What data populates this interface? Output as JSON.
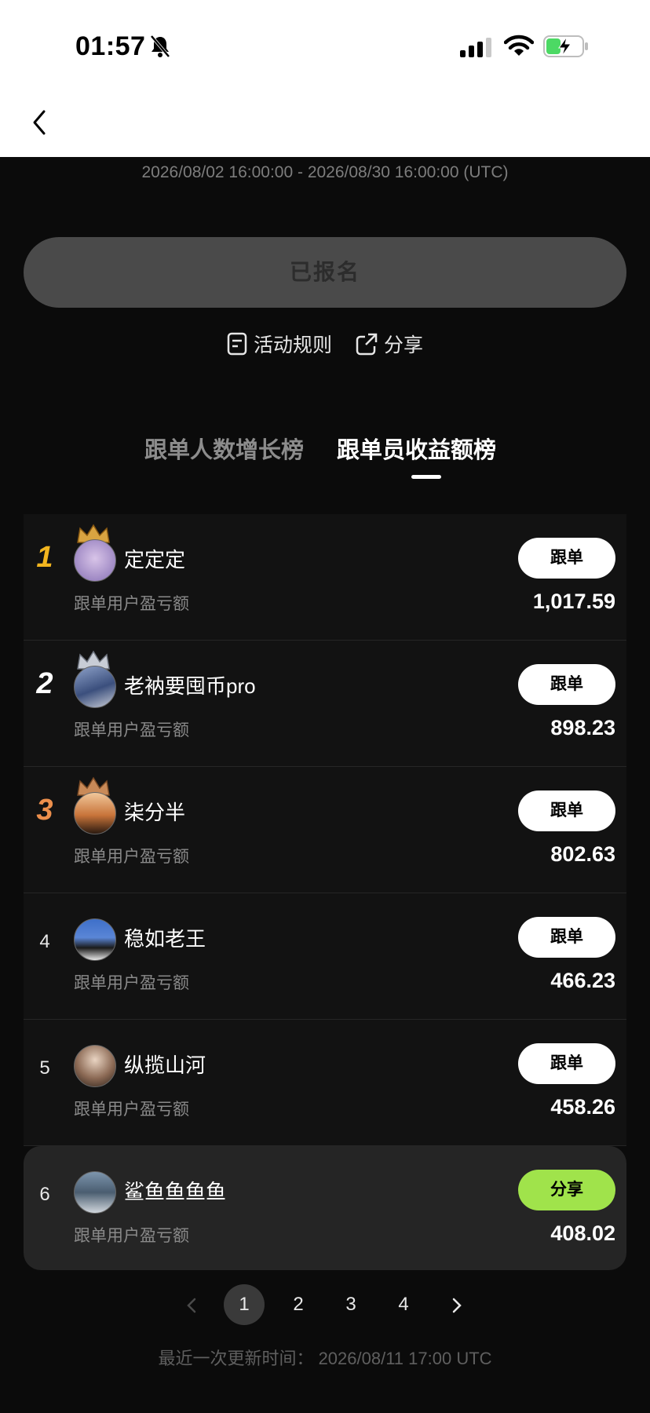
{
  "status_bar": {
    "time": "01:57"
  },
  "event": {
    "date_range": "2026/08/02 16:00:00 - 2026/08/30 16:00:00 (UTC)",
    "registered_label": "已报名",
    "rules_label": "活动规则",
    "share_label": "分享"
  },
  "tabs": [
    {
      "label": "跟单人数增长榜",
      "active": false
    },
    {
      "label": "跟单员收益额榜",
      "active": true
    }
  ],
  "leaderboard": [
    {
      "rank": "1",
      "name": "定定定",
      "sub": "跟单用户盈亏额",
      "value": "1,017.59",
      "button": "跟单",
      "rank_color": "#f2b51f",
      "crown": "#d9a441"
    },
    {
      "rank": "2",
      "name": "老衲要囤币pro",
      "sub": "跟单用户盈亏额",
      "value": "898.23",
      "button": "跟单",
      "rank_color": "#ffffff",
      "crown": "#c8cdd6"
    },
    {
      "rank": "3",
      "name": "柒分半",
      "sub": "跟单用户盈亏额",
      "value": "802.63",
      "button": "跟单",
      "rank_color": "#ec8f4c",
      "crown": "#c98a58"
    },
    {
      "rank": "4",
      "name": "稳如老王",
      "sub": "跟单用户盈亏额",
      "value": "466.23",
      "button": "跟单"
    },
    {
      "rank": "5",
      "name": "纵揽山河",
      "sub": "跟单用户盈亏额",
      "value": "458.26",
      "button": "跟单"
    },
    {
      "rank": "6",
      "name": "鲨鱼鱼鱼鱼",
      "sub": "跟单用户盈亏额",
      "value": "408.02",
      "button": "分享"
    }
  ],
  "pagination": {
    "pages": [
      "1",
      "2",
      "3",
      "4"
    ],
    "current": "1"
  },
  "footer": {
    "last_updated": "最近一次更新时间： 2026/08/11 17:00 UTC"
  },
  "colors": {
    "share_green": "#a0e34b",
    "background": "#0b0b0b"
  }
}
